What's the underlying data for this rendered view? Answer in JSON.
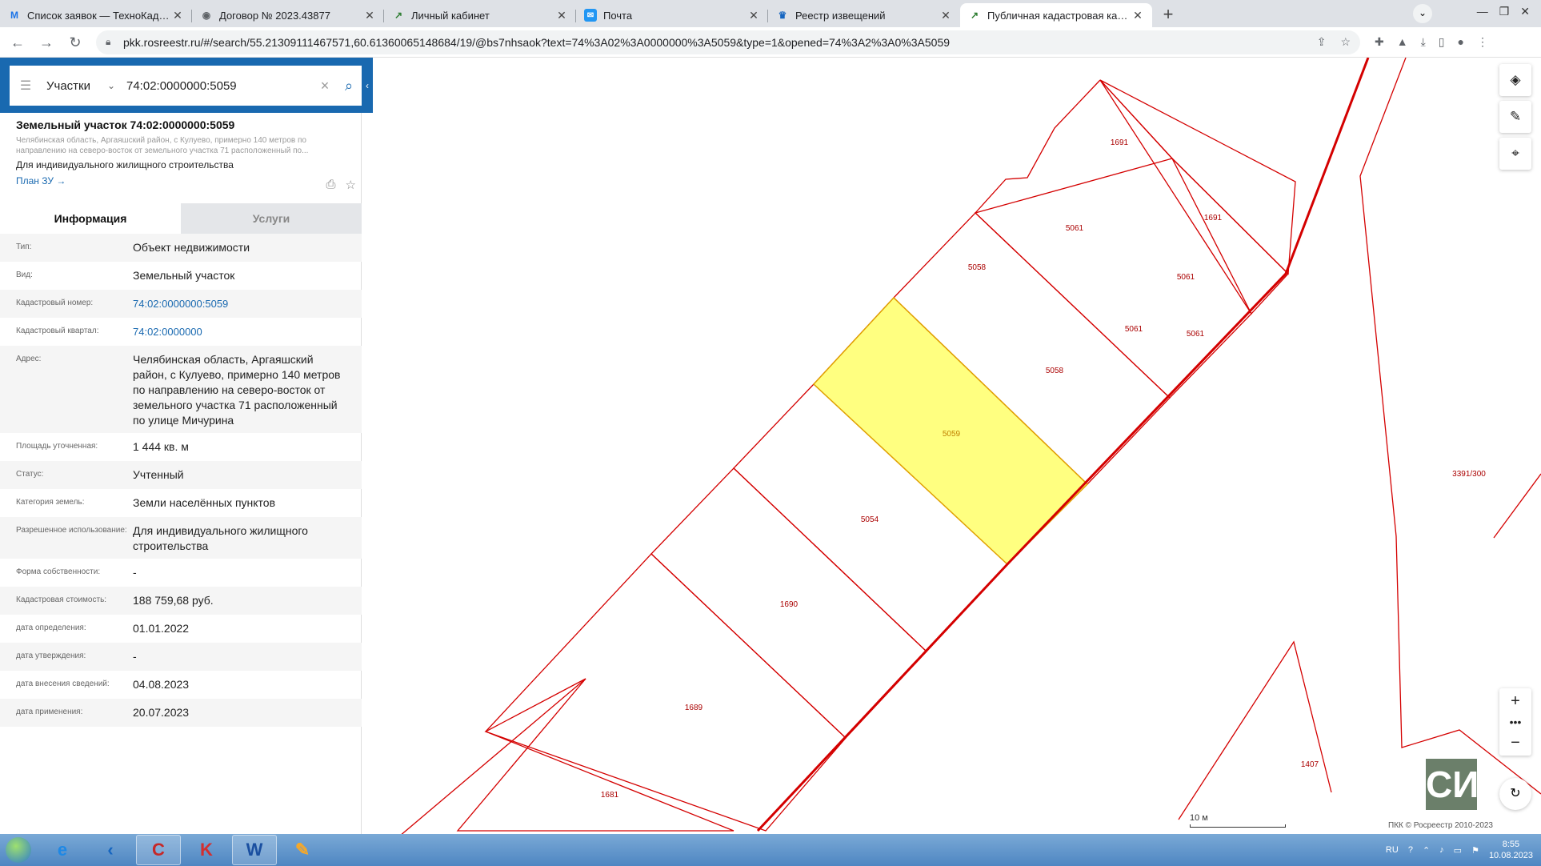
{
  "browser": {
    "tabs": [
      {
        "title": "Список заявок — ТехноКад-Муз",
        "icon": "gmail-icon",
        "icon_color": "#1a73e8"
      },
      {
        "title": "Договор № 2023.43877",
        "icon": "globe-icon",
        "icon_color": "#5f6368"
      },
      {
        "title": "Личный кабинет",
        "icon": "arrow-icon",
        "icon_color": "#2e7d32"
      },
      {
        "title": "Почта",
        "icon": "mail-icon",
        "icon_color": "#2196f3"
      },
      {
        "title": "Реестр извещений",
        "icon": "emblem-icon",
        "icon_color": "#1565c0"
      },
      {
        "title": "Публичная кадастровая карта",
        "icon": "pkk-icon",
        "icon_color": "#2e7d32"
      }
    ],
    "url": "pkk.rosreestr.ru/#/search/55.21309111467571,60.61360065148684/19/@bs7nhsaok?text=74%3A02%3A0000000%3A5059&type=1&opened=74%3A2%3A0%3A5059"
  },
  "search": {
    "type": "Участки",
    "value": "74:02:0000000:5059"
  },
  "object": {
    "title": "Земельный участок 74:02:0000000:5059",
    "address_short": "Челябинская область, Аргаяшский район, с Кулуево, примерно 140 метров по направлению на северо-восток от земельного участка 71 расположенный по...",
    "use": "Для индивидуального жилищного строительства",
    "plan_link": "План ЗУ →"
  },
  "tabs": {
    "info": "Информация",
    "services": "Услуги"
  },
  "info_rows": [
    {
      "key": "Тип:",
      "value": "Объект недвижимости"
    },
    {
      "key": "Вид:",
      "value": "Земельный участок"
    },
    {
      "key": "Кадастровый номер:",
      "value": "74:02:0000000:5059"
    },
    {
      "key": "Кадастровый квартал:",
      "value": "74:02:0000000"
    },
    {
      "key": "Адрес:",
      "value": "Челябинская область, Аргаяшский район, с Кулуево, примерно 140 метров по направлению на северо-восток от земельного участка 71 расположенный по улице Мичурина"
    },
    {
      "key": "Площадь уточненная:",
      "value": "1 444 кв. м"
    },
    {
      "key": "Статус:",
      "value": "Учтенный"
    },
    {
      "key": "Категория земель:",
      "value": "Земли населённых пунктов"
    },
    {
      "key": "Разрешенное использование:",
      "value": "Для индивидуального жилищного строительства"
    },
    {
      "key": "Форма собственности:",
      "value": "-"
    },
    {
      "key": "Кадастровая стоимость:",
      "value": "188 759,68 руб."
    },
    {
      "key": "дата определения:",
      "value": "01.01.2022"
    },
    {
      "key": "дата утверждения:",
      "value": "-"
    },
    {
      "key": "дата внесения сведений:",
      "value": "04.08.2023"
    },
    {
      "key": "дата применения:",
      "value": "20.07.2023"
    }
  ],
  "map": {
    "parcel_labels": [
      "1691",
      "1691",
      "5061",
      "5061",
      "5061",
      "5061",
      "5058",
      "5058",
      "5059",
      "5054",
      "1690",
      "1689",
      "1681",
      "3391/300",
      "1407"
    ],
    "scale_label": "10 м",
    "copyright": "ПКК © Росреестр 2010-2023",
    "basemap_thumb": "СИ",
    "colors": {
      "boundary": "#d40000",
      "selected_fill": "#ffff80",
      "selected_stroke": "#e0a000"
    }
  },
  "taskbar": {
    "apps": [
      "windows-explorer-icon",
      "ie-icon",
      "kompas-icon",
      "app-c-icon",
      "kaspersky-icon",
      "word-icon",
      "paint-icon"
    ],
    "lang": "RU",
    "time": "8:55",
    "date": "10.08.2023"
  }
}
